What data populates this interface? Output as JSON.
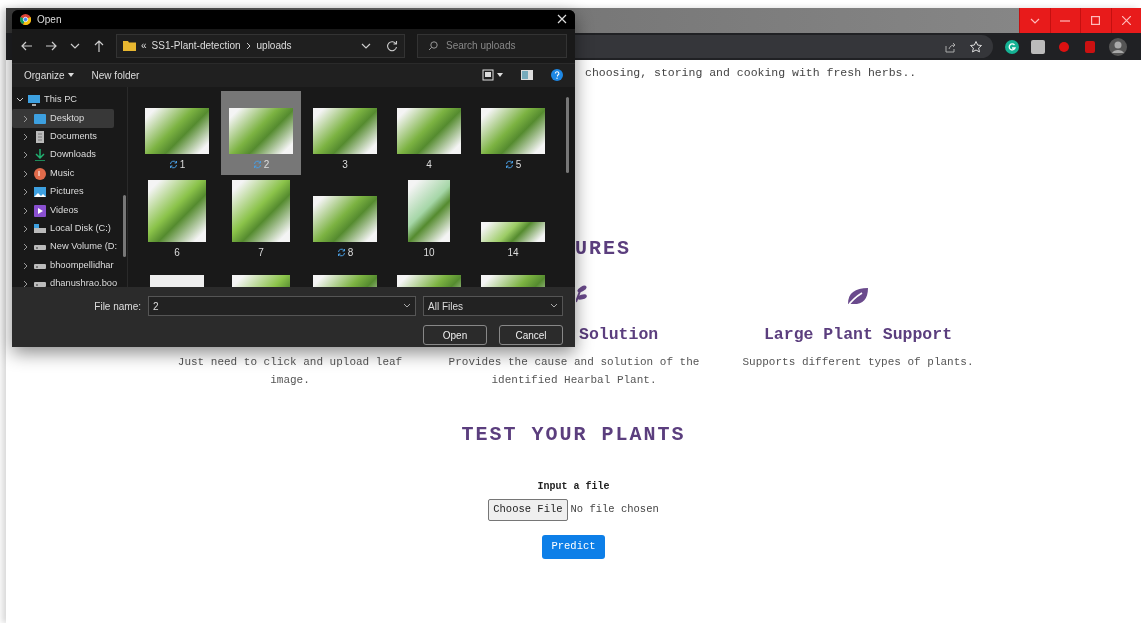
{
  "page": {
    "intro": "choosing, storing and cooking with fresh herbs..",
    "features_heading": "URES",
    "features": [
      {
        "description": "Just need to click and upload leaf image."
      },
      {
        "kind": "sprig",
        "title": "Solution",
        "description": "Provides the cause and solution of the identified Hearbal Plant."
      },
      {
        "kind": "leaf",
        "title": "Large Plant Support",
        "description": "Supports different types of plants."
      }
    ],
    "test_heading": "TEST YOUR PLANTS",
    "input_label": "Input a file",
    "choose_button": "Choose File",
    "file_status": "No file chosen",
    "predict_button": "Predict"
  },
  "dialog": {
    "title": "Open",
    "overflow_marker": "«",
    "path": [
      "SS1-Plant-detection",
      "uploads"
    ],
    "search_placeholder": "Search uploads",
    "organize": "Organize",
    "new_folder": "New folder",
    "tree": [
      {
        "label": "This PC",
        "kind": "pc",
        "expanded": true,
        "selected": false,
        "children": [
          {
            "label": "Desktop",
            "kind": "desktop",
            "selected": true
          },
          {
            "label": "Documents",
            "kind": "documents",
            "selected": false
          },
          {
            "label": "Downloads",
            "kind": "downloads",
            "selected": false
          },
          {
            "label": "Music",
            "kind": "music",
            "selected": false
          },
          {
            "label": "Pictures",
            "kind": "pictures",
            "selected": false
          },
          {
            "label": "Videos",
            "kind": "videos",
            "selected": false
          },
          {
            "label": "Local Disk (C:)",
            "kind": "disk",
            "selected": false
          },
          {
            "label": "New Volume (D:",
            "kind": "drive",
            "selected": false
          },
          {
            "label": "bhoompellidhar",
            "kind": "drive",
            "selected": false
          },
          {
            "label": "dhanushrao.boo",
            "kind": "drive",
            "selected": false
          }
        ]
      }
    ],
    "files": [
      {
        "label": "1",
        "kind": "landscape",
        "sync": true,
        "selected": false
      },
      {
        "label": "2",
        "kind": "landscape",
        "sync": true,
        "selected": true
      },
      {
        "label": "3",
        "kind": "landscape",
        "sync": false,
        "selected": false
      },
      {
        "label": "4",
        "kind": "landscape",
        "sync": false,
        "selected": false
      },
      {
        "label": "5",
        "kind": "landscape",
        "sync": true,
        "selected": false
      },
      {
        "label": "6",
        "kind": "portrait",
        "sync": false,
        "selected": false
      },
      {
        "label": "7",
        "kind": "portrait",
        "sync": false,
        "selected": false
      },
      {
        "label": "8",
        "kind": "landscape",
        "sync": true,
        "selected": false
      },
      {
        "label": "10",
        "kind": "tall",
        "sync": false,
        "selected": false
      },
      {
        "label": "14",
        "kind": "strip",
        "sync": false,
        "selected": false
      },
      {
        "kind": "document",
        "selected": false
      },
      {
        "kind": "portrait",
        "selected": false
      },
      {
        "kind": "landscape",
        "selected": false
      },
      {
        "kind": "landscape",
        "selected": false
      },
      {
        "kind": "landscape",
        "selected": false
      }
    ],
    "file_name_label": "File name:",
    "file_name_value": "2",
    "file_type": "All Files",
    "buttons": [
      "Open",
      "Cancel"
    ]
  }
}
